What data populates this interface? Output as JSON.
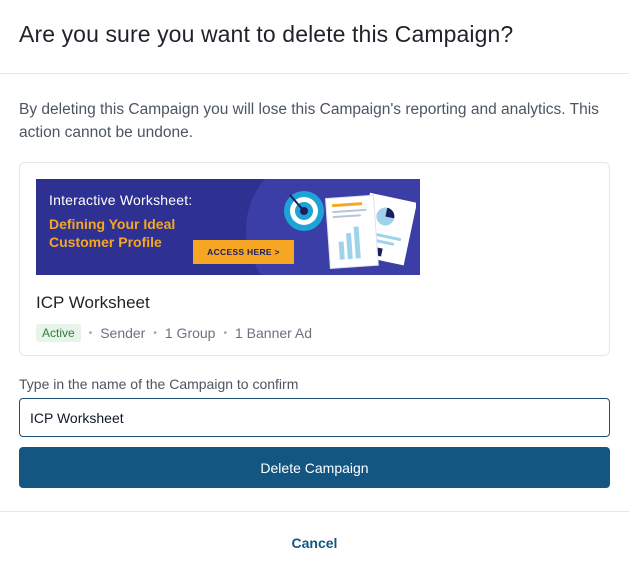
{
  "dialog": {
    "title": "Are you sure you want to delete this Campaign?",
    "warning": "By deleting this Campaign you will lose this Campaign's reporting and analytics. This action cannot be undone."
  },
  "campaign": {
    "banner": {
      "heading": "Interactive Worksheet:",
      "subheading": "Defining Your Ideal Customer Profile",
      "cta": "ACCESS HERE >"
    },
    "name": "ICP Worksheet",
    "status": "Active",
    "meta": [
      "Sender",
      "1 Group",
      "1 Banner Ad"
    ],
    "separator": "•"
  },
  "confirm": {
    "label": "Type in the name of the Campaign to confirm",
    "value": "ICP Worksheet"
  },
  "actions": {
    "delete_label": "Delete Campaign",
    "cancel_label": "Cancel"
  },
  "colors": {
    "primary": "#145682",
    "banner_bg": "#2e3191",
    "banner_accent": "#f6a623",
    "status_bg": "#e6f4ea",
    "status_text": "#2f7d3c"
  }
}
